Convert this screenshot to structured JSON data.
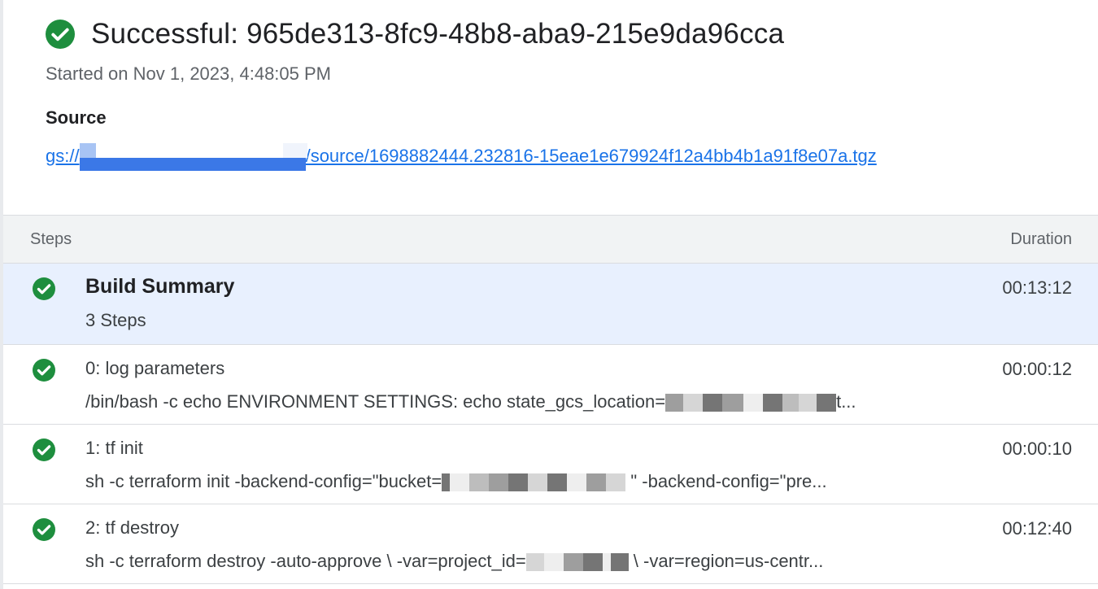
{
  "header": {
    "title": "Successful: 965de313-8fc9-48b8-aba9-215e9da96cca",
    "started": "Started on Nov 1, 2023, 4:48:05 PM",
    "source_label": "Source",
    "source_link_prefix": "gs://",
    "source_link_suffix": "/source/1698882444.232816-15eae1e679924f12a4bb4b1a91f8e07a.tgz",
    "status_color": "#1e8e3e",
    "status_icon": "check-circle-icon"
  },
  "steps": {
    "column_steps": "Steps",
    "column_duration": "Duration",
    "summary": {
      "name": "Build Summary",
      "sub": "3 Steps",
      "duration": "00:13:12"
    },
    "items": [
      {
        "name": "0: log parameters",
        "cmd_prefix": "/bin/bash -c echo ENVIRONMENT SETTINGS: echo state_gcs_location=",
        "cmd_suffix": "t...",
        "duration": "00:00:12"
      },
      {
        "name": "1: tf init",
        "cmd_prefix": "sh -c terraform init -backend-config=\"bucket=",
        "cmd_suffix": " \" -backend-config=\"pre...",
        "duration": "00:00:10"
      },
      {
        "name": "2: tf destroy",
        "cmd_prefix": "sh -c terraform destroy -auto-approve \\ -var=project_id=",
        "cmd_suffix": " \\ -var=region=us-centr...",
        "duration": "00:12:40"
      }
    ]
  }
}
